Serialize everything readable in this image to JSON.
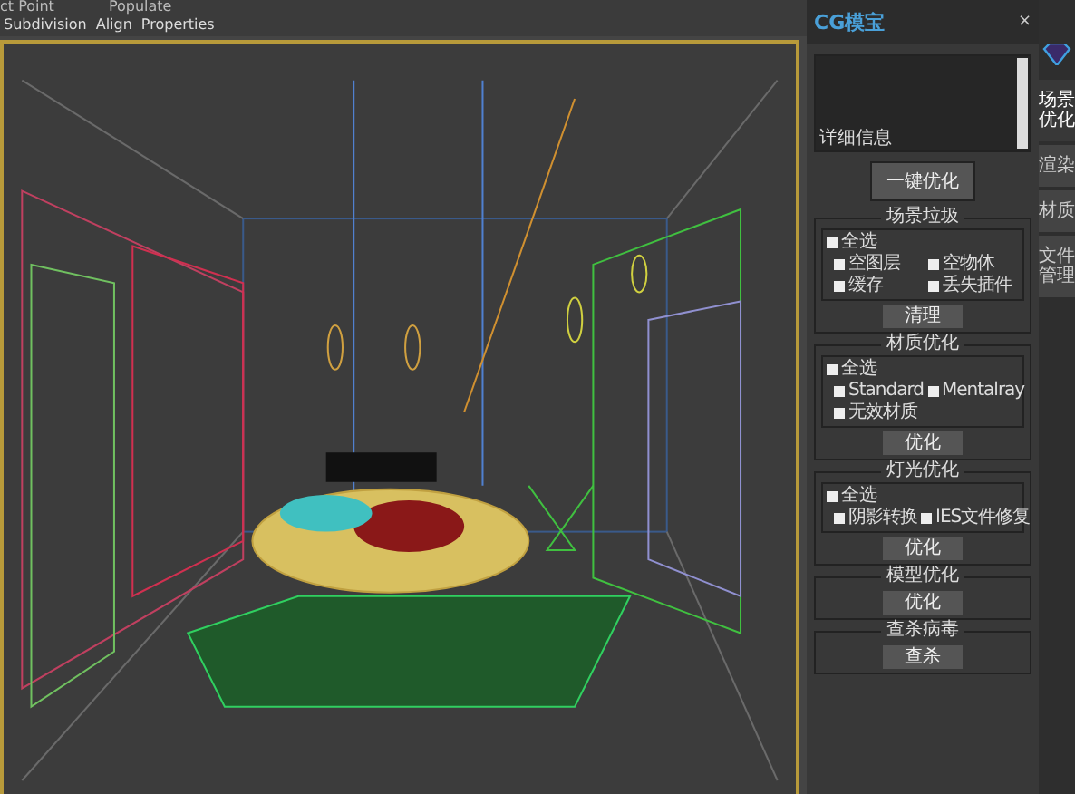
{
  "menu_top": [
    "ct Point",
    "Populate"
  ],
  "menu": [
    "Subdivision",
    "Align",
    "Properties"
  ],
  "panel": {
    "title": "CG模宝",
    "close": "×",
    "info_label": "详细信息",
    "main_button": "一键优化",
    "groups": [
      {
        "title": "场景垃圾",
        "select_all": {
          "label": "全选",
          "checked": false
        },
        "options": [
          {
            "label": "空图层",
            "checked": false
          },
          {
            "label": "空物体",
            "checked": false
          },
          {
            "label": "缓存",
            "checked": false
          },
          {
            "label": "丢失插件",
            "checked": false
          }
        ],
        "button": "清理"
      },
      {
        "title": "材质优化",
        "select_all": {
          "label": "全选",
          "checked": false
        },
        "options": [
          {
            "label": "Standard",
            "checked": false
          },
          {
            "label": "Mentalray",
            "checked": false
          },
          {
            "label": "无效材质",
            "checked": false
          }
        ],
        "button": "优化"
      },
      {
        "title": "灯光优化",
        "select_all": {
          "label": "全选",
          "checked": false
        },
        "options": [
          {
            "label": "阴影转换",
            "checked": false
          },
          {
            "label": "IES文件修复",
            "checked": false
          }
        ],
        "button": "优化"
      },
      {
        "title": "模型优化",
        "button": "优化"
      },
      {
        "title": "查杀病毒",
        "button": "查杀"
      }
    ]
  },
  "side_tabs": [
    {
      "label": "场景优化",
      "selected": true
    },
    {
      "label": "渲染",
      "selected": false
    },
    {
      "label": "材质",
      "selected": false
    },
    {
      "label": "文件管理",
      "selected": false
    }
  ]
}
